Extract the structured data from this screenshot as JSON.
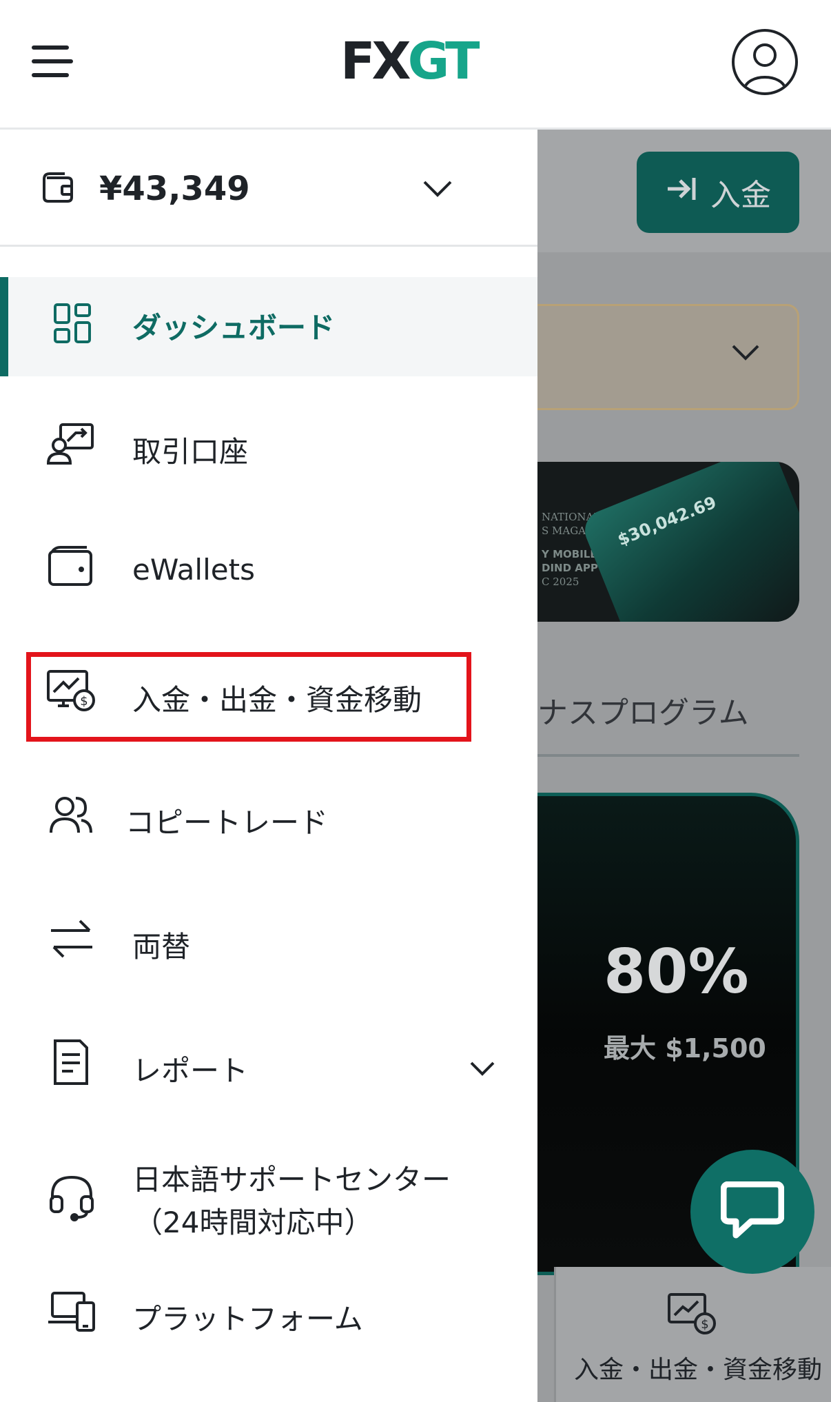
{
  "header": {
    "logo_fx": "FX",
    "logo_gt": "GT"
  },
  "drawer": {
    "balance": "¥43,349",
    "items": [
      {
        "label": "ダッシュボード",
        "icon": "dashboard-grid-icon",
        "active": true
      },
      {
        "label": "取引口座",
        "icon": "trading-account-icon"
      },
      {
        "label": "eWallets",
        "icon": "wallet-icon"
      },
      {
        "label": "入金・出金・資金移動",
        "icon": "funds-transfer-icon"
      },
      {
        "label": "コピートレード",
        "icon": "users-icon"
      },
      {
        "label": "両替",
        "icon": "exchange-arrows-icon"
      },
      {
        "label": "レポート",
        "icon": "document-icon"
      },
      {
        "label": "日本語サポートセンター",
        "label2": "（24時間対応中）",
        "icon": "headset-icon"
      },
      {
        "label": "プラットフォーム",
        "icon": "devices-icon"
      }
    ]
  },
  "background": {
    "deposit_label": "入金",
    "banner_lines": [
      "NATIONAL",
      "S MAGAZINE",
      "Y MOBILE",
      "DIND APP",
      "C 2025"
    ],
    "banner_amount": "$30,042.69",
    "bonus_title": "ナスプログラム",
    "bonus_percent": "80%",
    "bonus_max": "最大 $1,500",
    "bottom_tab_label": "入金・出金・資金移動"
  },
  "colors": {
    "accent": "#0e6b63",
    "logo_green": "#16a58a",
    "highlight": "#e3141b"
  }
}
